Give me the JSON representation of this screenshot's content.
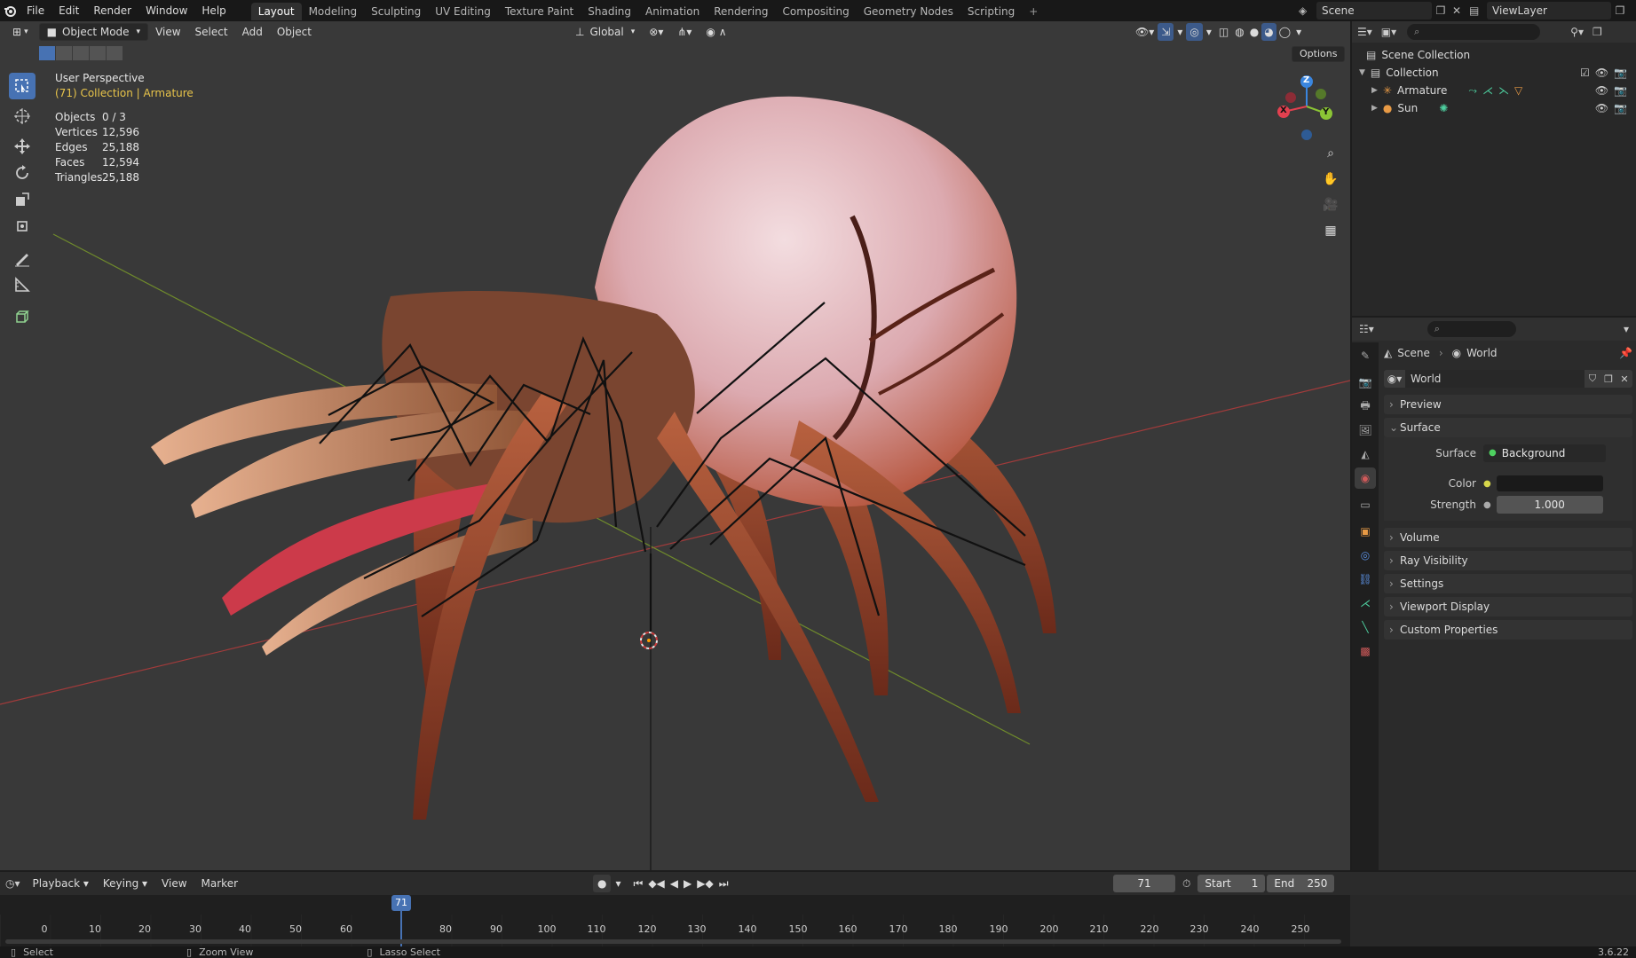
{
  "menu": {
    "items": [
      "File",
      "Edit",
      "Render",
      "Window",
      "Help"
    ],
    "workspace_tabs": [
      "Layout",
      "Modeling",
      "Sculpting",
      "UV Editing",
      "Texture Paint",
      "Shading",
      "Animation",
      "Rendering",
      "Compositing",
      "Geometry Nodes",
      "Scripting"
    ],
    "active_tab": "Layout",
    "scene_name": "Scene",
    "view_layer": "ViewLayer"
  },
  "viewport": {
    "mode": "Object Mode",
    "menus": [
      "View",
      "Select",
      "Add",
      "Object"
    ],
    "transform_orientation": "Global",
    "options_label": "Options",
    "overlay_title": "User Perspective",
    "overlay_subtitle": "(71) Collection | Armature",
    "stats": [
      {
        "label": "Objects",
        "value": "0 / 3"
      },
      {
        "label": "Vertices",
        "value": "12,596"
      },
      {
        "label": "Edges",
        "value": "25,188"
      },
      {
        "label": "Faces",
        "value": "12,594"
      },
      {
        "label": "Triangles",
        "value": "25,188"
      }
    ],
    "gizmo_axes": {
      "x": "X",
      "y": "Y",
      "z": "Z"
    },
    "axis_colors": {
      "x": "#e3404f",
      "y": "#8bc535",
      "z": "#3a86e0"
    }
  },
  "outliner": {
    "search_placeholder": "",
    "root": "Scene Collection",
    "collection": "Collection",
    "items": [
      {
        "name": "Armature",
        "icon": "armature-icon"
      },
      {
        "name": "Sun",
        "icon": "light-icon"
      }
    ]
  },
  "properties": {
    "breadcrumb": {
      "scene": "Scene",
      "world": "World"
    },
    "datablock_name": "World",
    "panels": {
      "preview": "Preview",
      "surface": "Surface",
      "volume": "Volume",
      "ray_visibility": "Ray Visibility",
      "settings": "Settings",
      "viewport_display": "Viewport Display",
      "custom_properties": "Custom Properties"
    },
    "surface": {
      "surface_label": "Surface",
      "surface_value": "Background",
      "color_label": "Color",
      "strength_label": "Strength",
      "strength_value": "1.000"
    }
  },
  "timeline": {
    "menus": [
      "Playback",
      "Keying",
      "View",
      "Marker"
    ],
    "current_frame": "71",
    "start_label": "Start",
    "start_value": "1",
    "end_label": "End",
    "end_value": "250",
    "ruler": [
      "0",
      "10",
      "20",
      "30",
      "40",
      "50",
      "60",
      "71",
      "80",
      "90",
      "100",
      "110",
      "120",
      "130",
      "140",
      "150",
      "160",
      "170",
      "180",
      "190",
      "200",
      "210",
      "220",
      "230",
      "240",
      "250"
    ]
  },
  "status": {
    "select": "Select",
    "zoom_view": "Zoom View",
    "lasso_select": "Lasso Select",
    "version": "3.6.22"
  }
}
